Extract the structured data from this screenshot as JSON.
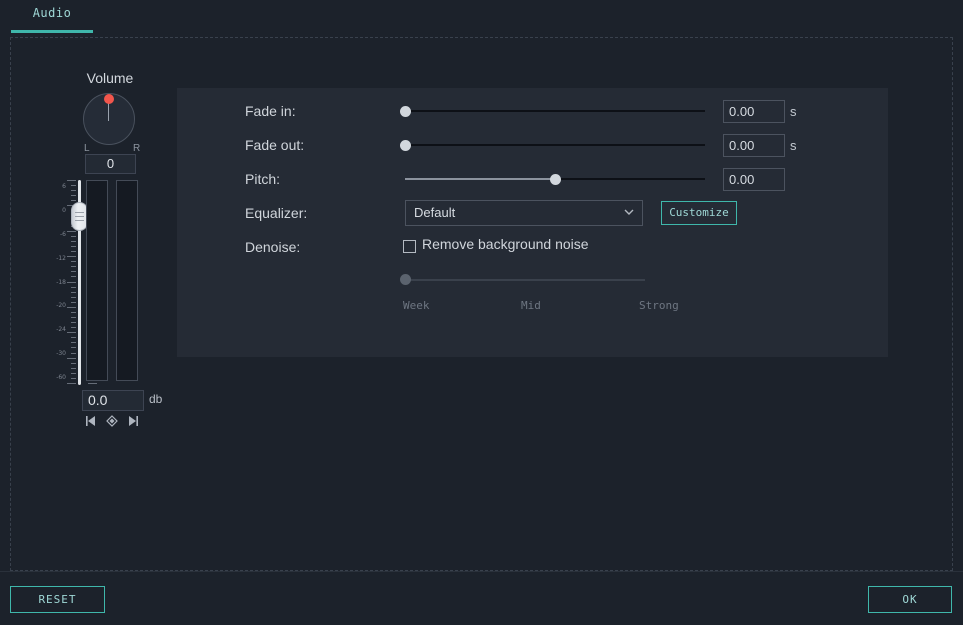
{
  "tabs": [
    {
      "label": "Audio",
      "active": true
    }
  ],
  "volume": {
    "title": "Volume",
    "left_label": "L",
    "right_label": "R",
    "value": "0",
    "knob_icon": "rotary-knob-icon",
    "db_value": "0.0",
    "db_unit": "db",
    "scale_labels": [
      "6",
      "0",
      "-6",
      "-12",
      "-18",
      "-20",
      "-24",
      "-30",
      "-60"
    ],
    "buttons": [
      {
        "name": "previous-keyframe-button",
        "glyph": "◀|"
      },
      {
        "name": "add-keyframe-button",
        "glyph": "◈"
      },
      {
        "name": "next-keyframe-button",
        "glyph": "|▶"
      }
    ]
  },
  "settings": {
    "fade_in": {
      "label": "Fade in:",
      "value": "0.00",
      "unit": "s",
      "slider_percent": 0
    },
    "fade_out": {
      "label": "Fade out:",
      "value": "0.00",
      "unit": "s",
      "slider_percent": 0
    },
    "pitch": {
      "label": "Pitch:",
      "value": "0.00",
      "unit": "",
      "slider_percent": 50
    },
    "equalizer": {
      "label": "Equalizer:",
      "selected": "Default",
      "options": [
        "Default"
      ],
      "customize_label": "Customize"
    },
    "denoise": {
      "label": "Denoise:",
      "checkbox_label": "Remove background noise",
      "checked": false,
      "slider_percent": 0,
      "tick_labels": [
        "Week",
        "Mid",
        "Strong"
      ]
    }
  },
  "footer": {
    "reset_label": "RESET",
    "ok_label": "OK"
  },
  "colors": {
    "accent": "#3fb7ab",
    "accent_text": "#9fd8d6",
    "background": "#1c222b",
    "panel": "#252b35",
    "knob_dot": "#f2564c"
  }
}
